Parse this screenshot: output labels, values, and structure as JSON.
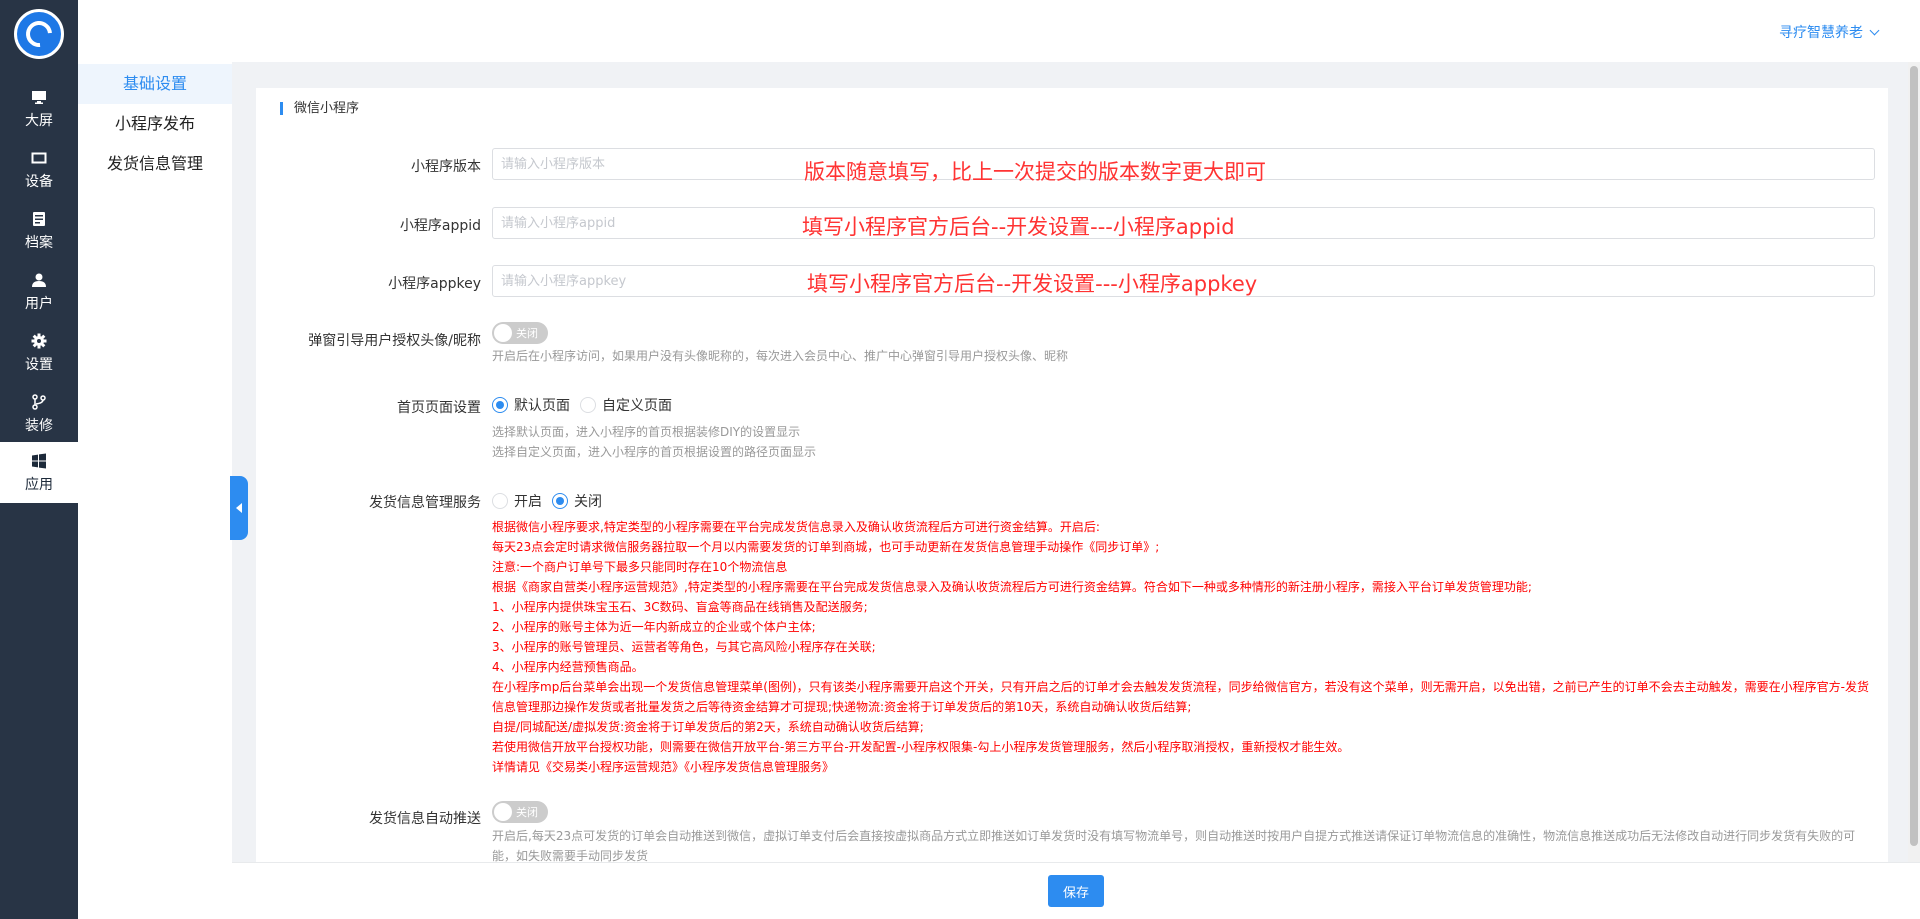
{
  "nav": {
    "items": [
      {
        "label": "大屏",
        "icon": "monitor-icon"
      },
      {
        "label": "设备",
        "icon": "device-icon"
      },
      {
        "label": "档案",
        "icon": "archive-icon"
      },
      {
        "label": "用户",
        "icon": "user-icon"
      },
      {
        "label": "设置",
        "icon": "gear-icon"
      },
      {
        "label": "装修",
        "icon": "branch-icon"
      },
      {
        "label": "应用",
        "icon": "windows-icon"
      }
    ],
    "active": "应用"
  },
  "submenu": {
    "items": [
      "基础设置",
      "小程序发布",
      "发货信息管理"
    ],
    "active": "基础设置"
  },
  "topbar": {
    "user": "寻疗智慧养老"
  },
  "card": {
    "title": "微信小程序",
    "version": {
      "label": "小程序版本",
      "placeholder": "请输入小程序版本",
      "note": "版本随意填写，比上一次提交的版本数字更大即可"
    },
    "appid": {
      "label": "小程序appid",
      "placeholder": "请输入小程序appid",
      "note": "填写小程序官方后台--开发设置---小程序appid"
    },
    "appkey": {
      "label": "小程序appkey",
      "placeholder": "请输入小程序appkey",
      "note": "填写小程序官方后台--开发设置---小程序appkey"
    },
    "popup": {
      "label": "弹窗引导用户授权头像/昵称",
      "switch_text": "关闭",
      "hint": "开启后在小程序访问，如果用户没有头像昵称的，每次进入会员中心、推广中心弹窗引导用户授权头像、昵称"
    },
    "homepage": {
      "label": "首页页面设置",
      "options": [
        "默认页面",
        "自定义页面"
      ],
      "selected": "默认页面",
      "hint1": "选择默认页面，进入小程序的首页根据装修DIY的设置显示",
      "hint2": "选择自定义页面，进入小程序的首页根据设置的路径页面显示"
    },
    "shipping": {
      "label": "发货信息管理服务",
      "options": [
        "开启",
        "关闭"
      ],
      "selected": "关闭",
      "lines": [
        "根据微信小程序要求,特定类型的小程序需要在平台完成发货信息录入及确认收货流程后方可进行资金结算。开启后:",
        "每天23点会定时请求微信服务器拉取一个月以内需要发货的订单到商城，也可手动更新在发货信息管理手动操作《同步订单》;",
        "注意:一个商户订单号下最多只能同时存在10个物流信息",
        "根据《商家自营类小程序运营规范》,特定类型的小程序需要在平台完成发货信息录入及确认收货流程后方可进行资金结算。符合如下一种或多种情形的新注册小程序，需接入平台订单发货管理功能;",
        "1、小程序内提供珠宝玉石、3C数码、盲盒等商品在线销售及配送服务;",
        "2、小程序的账号主体为近一年内新成立的企业或个体户主体;",
        "3、小程序的账号管理员、运营者等角色，与其它高风险小程序存在关联;",
        "4、小程序内经营预售商品。",
        "在小程序mp后台菜单会出现一个发货信息管理菜单(图例)，只有该类小程序需要开启这个开关，只有开启之后的订单才会去触发发货流程，同步给微信官方，若没有这个菜单，则无需开启，以免出错，之前已产生的订单不会去主动触发，需要在小程序官方-发货信息管理那边操作发货或者批量发货之后等待资金结算才可提现;快递物流:资金将于订单发货后的第10天，系统自动确认收货后结算;",
        "自提/同城配送/虚拟发货:资金将于订单发货后的第2天，系统自动确认收货后结算;",
        "若使用微信开放平台授权功能，则需要在微信开放平台-第三方平台-开发配置-小程序权限集-勾上小程序发货管理服务，然后小程序取消授权，重新授权才能生效。",
        "详情请见《交易类小程序运营规范》《小程序发货信息管理服务》"
      ]
    },
    "autopush": {
      "label": "发货信息自动推送",
      "switch_text": "关闭",
      "hint": "开启后,每天23点可发货的订单会自动推送到微信，虚拟订单支付后会直接按虚拟商品方式立即推送如订单发货时没有填写物流单号，则自动推送时按用户自提方式推送请保证订单物流信息的准确性，物流信息推送成功后无法修改自动进行同步发货有失败的可能，如失败需要手动同步发货"
    }
  },
  "footer": {
    "save": "保存"
  },
  "colors": {
    "nav_bg": "#283445",
    "accent": "#2d8cf0",
    "red_note": "#ff3333"
  }
}
